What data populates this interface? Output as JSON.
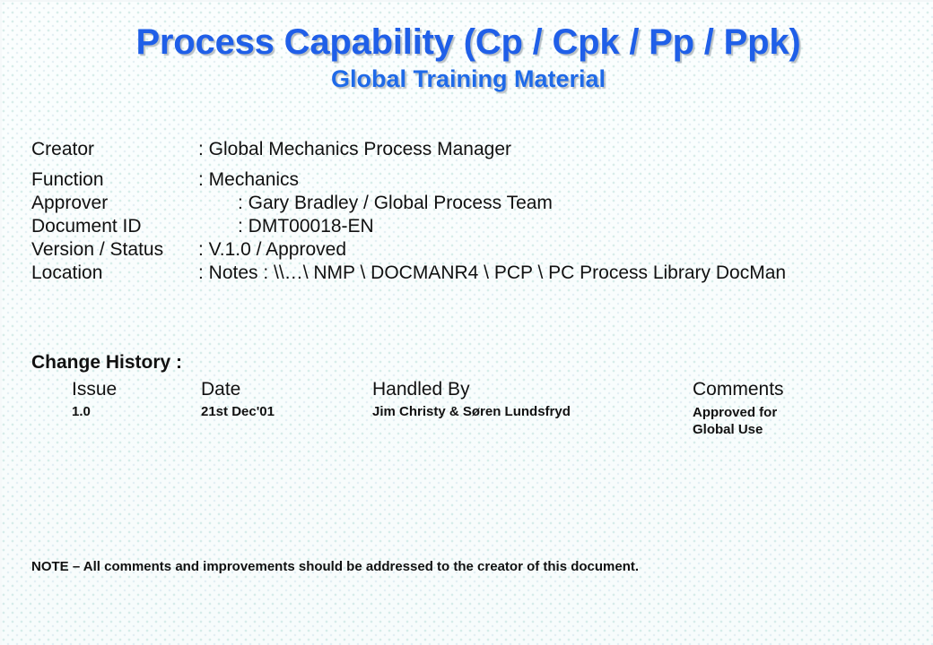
{
  "slide": {
    "title": "Process Capability (Cp / Cpk / Pp / Ppk)",
    "subtitle": "Global Training Material",
    "title_color": "#1f5fe8",
    "subtitle_color": "#1f6ae8",
    "background_color": "#fdfefe",
    "text_color": "#111111"
  },
  "meta": {
    "rows": [
      {
        "label": "Creator",
        "value": ": Global Mechanics Process Manager"
      },
      {
        "label": "Function",
        "value": ": Mechanics"
      },
      {
        "label": "Approver",
        "value": ": Gary Bradley / Global Process Team"
      },
      {
        "label": "Document ID",
        "value": ": DMT00018-EN"
      },
      {
        "label": "Version / Status",
        "value": ": V.1.0 / Approved"
      },
      {
        "label": "Location",
        "value": ": Notes : \\\\…\\ NMP \\ DOCMANR4 \\ PCP \\ PC Process Library DocMan"
      }
    ]
  },
  "change_history": {
    "heading": "Change History :",
    "columns": [
      "Issue",
      "Date",
      "Handled By",
      "Comments"
    ],
    "rows": [
      {
        "issue": "1.0",
        "date": "21st Dec'01",
        "handled_by": "Jim Christy & Søren Lundsfryd",
        "comments": "Approved for Global Use"
      }
    ]
  },
  "note": "NOTE – All comments and improvements should be addressed to the creator of this document."
}
